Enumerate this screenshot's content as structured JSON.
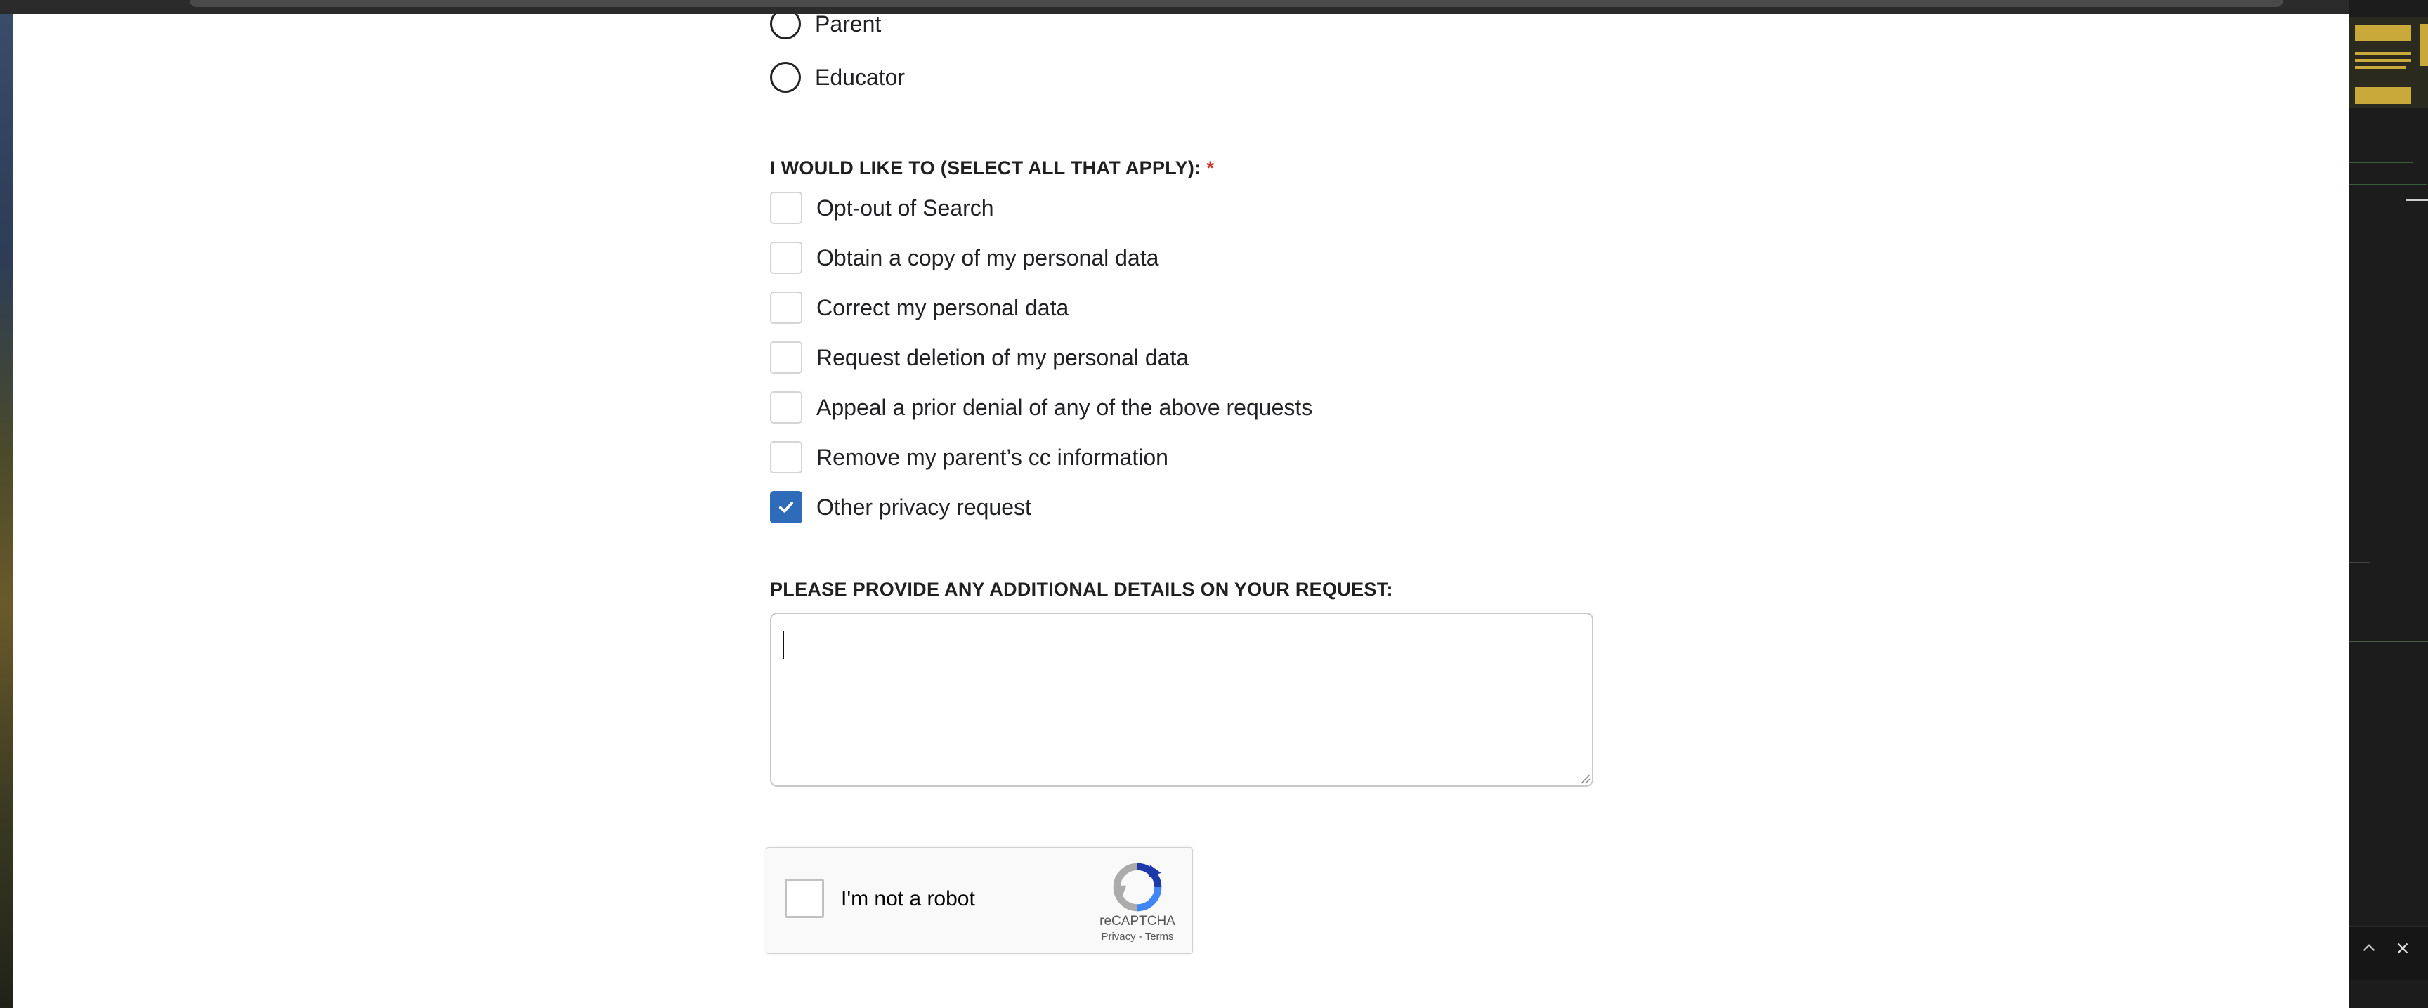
{
  "role_options": [
    {
      "label": "Parent"
    },
    {
      "label": "Educator"
    }
  ],
  "request_question": {
    "label": "I WOULD LIKE TO (SELECT ALL THAT APPLY):",
    "required_mark": "*"
  },
  "request_options": [
    {
      "label": "Opt-out of Search",
      "checked": false
    },
    {
      "label": "Obtain a copy of my personal data",
      "checked": false
    },
    {
      "label": "Correct my personal data",
      "checked": false
    },
    {
      "label": "Request deletion of my personal data",
      "checked": false
    },
    {
      "label": "Appeal a prior denial of any of the above requests",
      "checked": false
    },
    {
      "label": "Remove my parent’s cc information",
      "checked": false
    },
    {
      "label": "Other privacy request",
      "checked": true
    }
  ],
  "details": {
    "label": "PLEASE PROVIDE ANY ADDITIONAL DETAILS ON YOUR REQUEST:",
    "value": ""
  },
  "recaptcha": {
    "checkbox_label": "I'm not a robot",
    "brand": "reCAPTCHA",
    "privacy_link": "Privacy",
    "separator": "-",
    "terms_link": "Terms"
  },
  "colors": {
    "checked_accent": "#2e6bb8",
    "required_mark": "#d32f2f"
  },
  "icons": {
    "check": "check-icon",
    "recaptcha_logo": "recaptcha-logo-icon",
    "window_up": "chevron-up-icon",
    "window_close": "close-icon"
  }
}
